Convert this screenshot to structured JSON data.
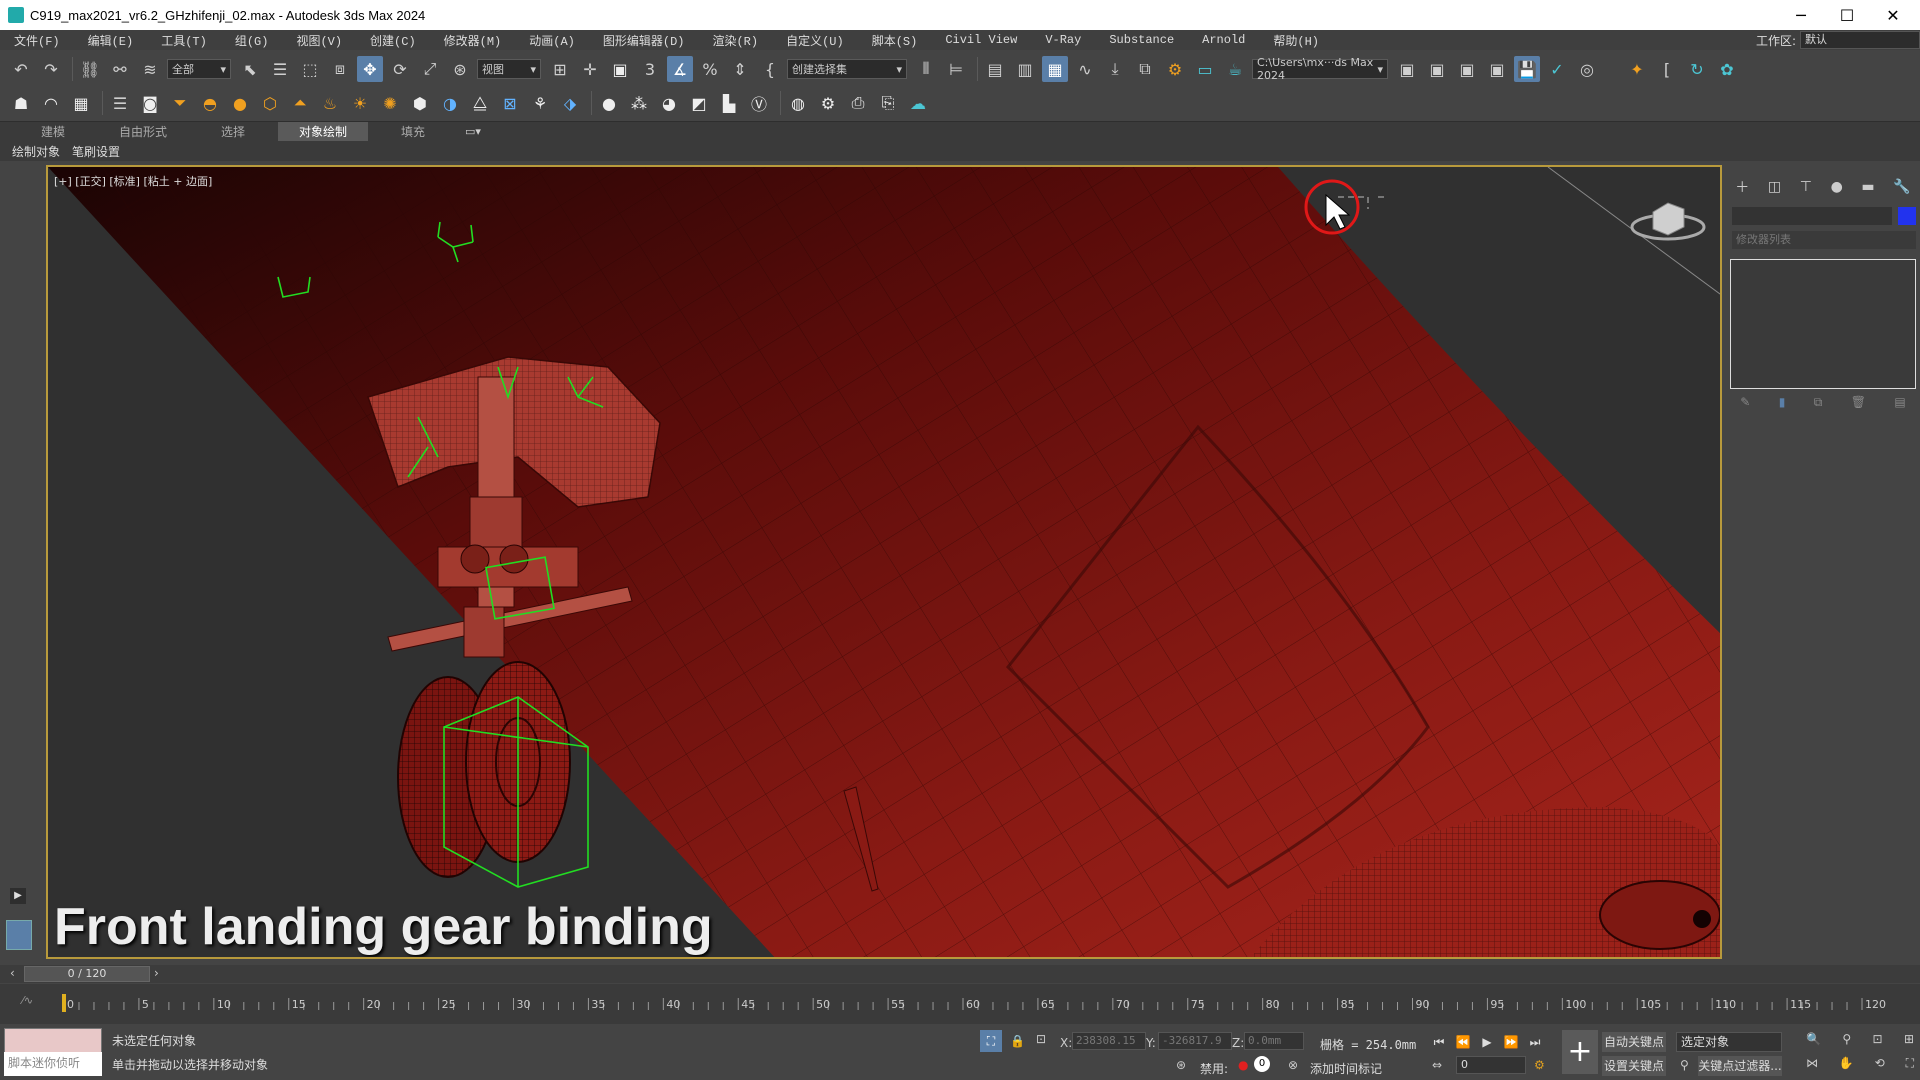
{
  "window": {
    "title": "C919_max2021_vr6.2_GHzhifenji_02.max - Autodesk 3ds Max 2024",
    "minimize": "─",
    "maximize": "☐",
    "close": "✕"
  },
  "menu": [
    "文件(F)",
    "编辑(E)",
    "工具(T)",
    "组(G)",
    "视图(V)",
    "创建(C)",
    "修改器(M)",
    "动画(A)",
    "图形编辑器(D)",
    "渲染(R)",
    "自定义(U)",
    "脚本(S)",
    "Civil View",
    "V-Ray",
    "Substance",
    "Arnold",
    "帮助(H)"
  ],
  "workspace": {
    "label": "工作区:",
    "value": "默认"
  },
  "toolbar": {
    "filter_value": "全部",
    "ref_coord_value": "视图",
    "selset_value": "创建选择集",
    "path_value": "C:\\Users\\mx···ds Max 2024"
  },
  "ribbon": {
    "tabs": [
      "建模",
      "自由形式",
      "选择",
      "对象绘制",
      "填充"
    ],
    "active_index": 3,
    "subtabs": [
      "绘制对象",
      "笔刷设置"
    ]
  },
  "viewport": {
    "label": "[+] [正交] [标准] [粘土 + 边面]",
    "caption": "Front landing gear binding"
  },
  "command_panel": {
    "modifier_list": "修改器列表"
  },
  "timeline": {
    "frame_display": "0 / 120",
    "ticks": [
      0,
      5,
      10,
      15,
      20,
      25,
      30,
      35,
      40,
      45,
      50,
      55,
      60,
      65,
      70,
      75,
      80,
      85,
      90,
      95,
      100,
      105,
      110,
      115,
      120
    ]
  },
  "status": {
    "script_hint": "脚本迷你侦听",
    "selection": "未选定任何对象",
    "prompt": "单击并拖动以选择并移动对象",
    "x_label": "X:",
    "x_value": "238308.15",
    "y_label": "Y:",
    "y_value": "-326817.9",
    "z_label": "Z:",
    "z_value": "0.0mm",
    "grid": "栅格 = 254.0mm",
    "disabled": "禁用:",
    "add_time_tag": "添加时间标记",
    "frame_value": "0",
    "auto_key": "自动关键点",
    "set_key": "设置关键点",
    "selected_object": "选定对象",
    "key_filters": "关键点过滤器..."
  },
  "colors": {
    "fuselage": "#8a1a14",
    "frame": "#b89a3c",
    "selection": "#22dd22"
  }
}
